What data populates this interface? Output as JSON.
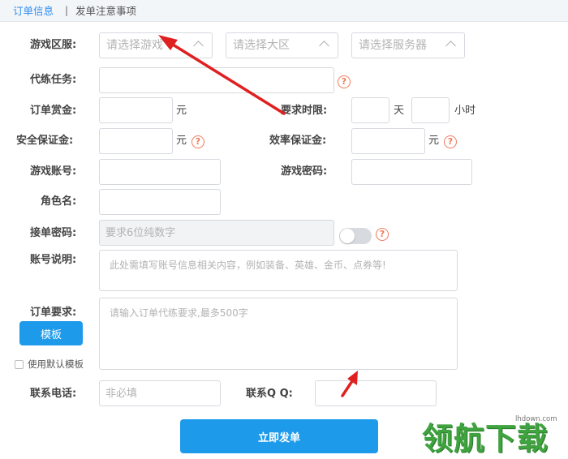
{
  "tabs": {
    "order_info": "订单信息",
    "separator": "|",
    "notes": "发单注意事项"
  },
  "labels": {
    "game_server": "游戏区服:",
    "task": "代练任务:",
    "reward": "订单赏金:",
    "time_limit": "要求时限:",
    "security_deposit": "安全保证金:",
    "efficiency_deposit": "效率保证金:",
    "account": "游戏账号:",
    "password": "游戏密码:",
    "role_name": "角色名:",
    "accept_password": "接单密码:",
    "account_desc": "账号说明:",
    "order_requirements": "订单要求:",
    "phone": "联系电话:",
    "qq": "联系Q Q:"
  },
  "selects": {
    "game": "请选择游戏",
    "region": "请选择大区",
    "server": "请选择服务器"
  },
  "units": {
    "yuan": "元",
    "day": "天",
    "hour": "小时"
  },
  "placeholders": {
    "accept_password": "要求6位纯数字",
    "account_desc": "此处需填写账号信息相关内容，例如装备、英雄、金币、点券等!",
    "order_requirements": "请输入订单代练要求,最多500字",
    "phone": "非必填"
  },
  "help_icon": "?",
  "buttons": {
    "template": "模板",
    "submit": "立即发单"
  },
  "checkbox": {
    "label": "使用默认模板",
    "checked": false
  },
  "toggle": {
    "on": false
  },
  "colors": {
    "accent": "#1e9aea",
    "tab_active": "#2d8cf0",
    "help": "#f07a5a",
    "annotation_arrow": "#e02020",
    "watermark": "#3fa33f"
  },
  "watermark": {
    "site": "lhdown.com",
    "text": "领航下载"
  }
}
